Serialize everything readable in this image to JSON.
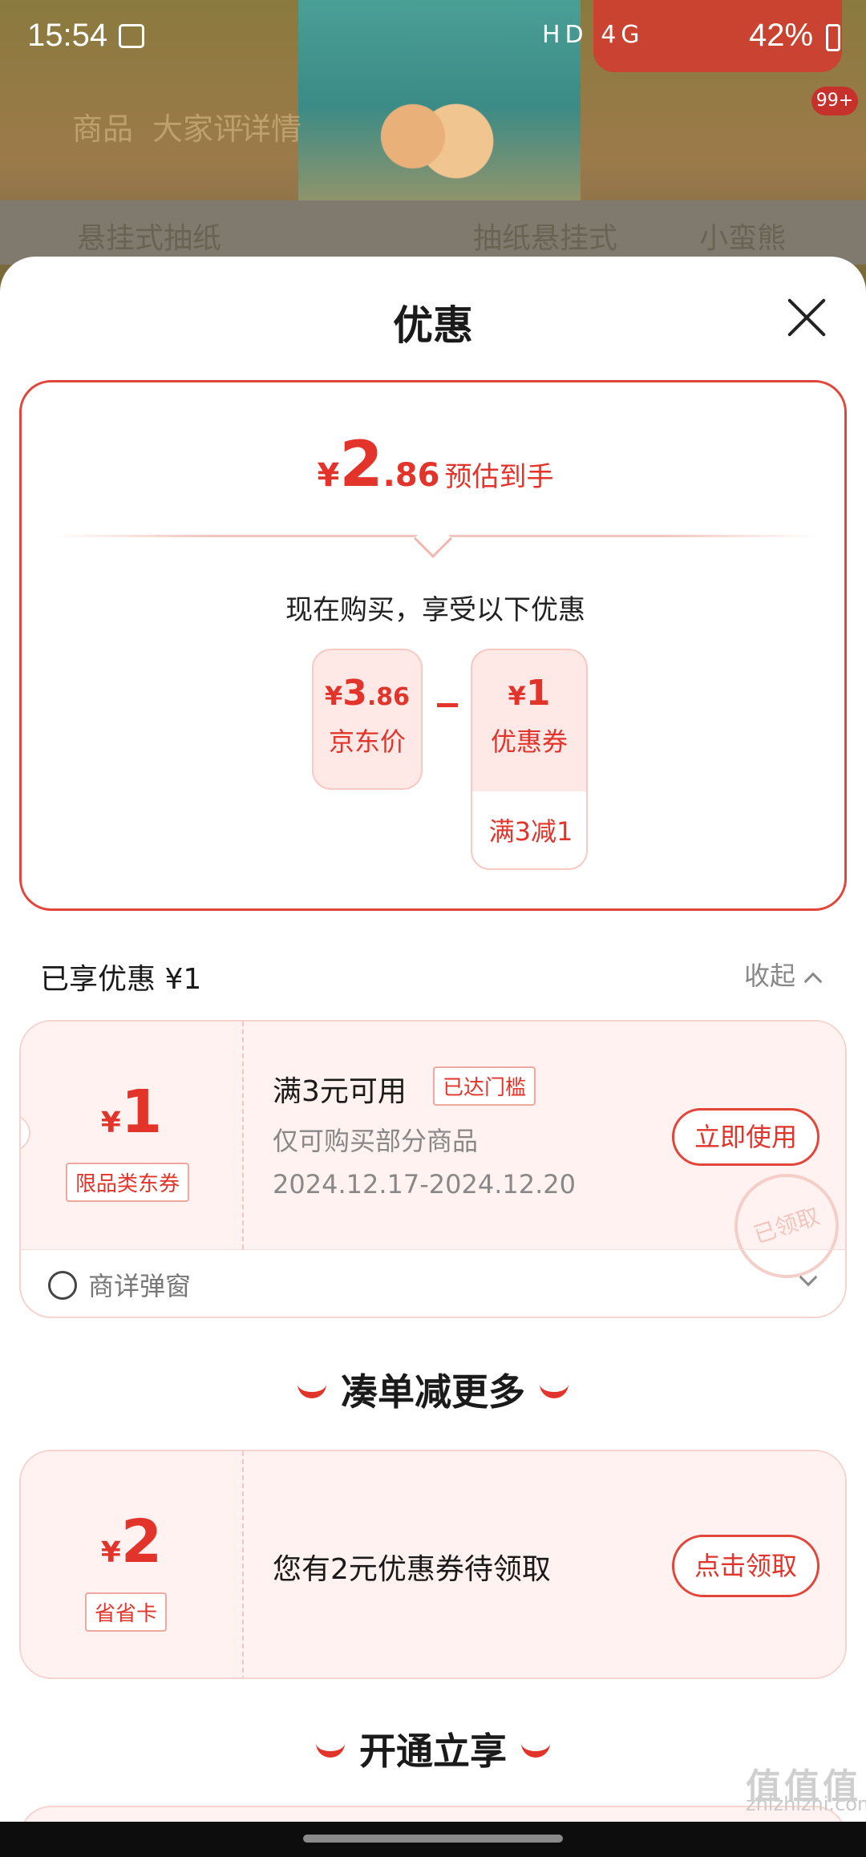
{
  "status_bar": {
    "time": "15:54",
    "icons": "HD 4G",
    "battery": "42%"
  },
  "background": {
    "nav_tabs": [
      "商品",
      "大家评",
      "详情"
    ],
    "badge": "99+",
    "search_placeholder": "悬挂式抽纸",
    "search_chips": [
      "抽纸悬挂式",
      "小蛮熊"
    ]
  },
  "sheet": {
    "title": "优惠",
    "estimate": {
      "currency": "¥",
      "integer": "2",
      "decimal": ".86",
      "label": "预估到手"
    },
    "subtitle": "现在购买，享受以下优惠",
    "price_box": {
      "currency": "¥",
      "integer": "3",
      "decimal": ".86",
      "label": "京东价"
    },
    "coupon_box": {
      "currency": "¥",
      "integer": "1",
      "label": "优惠券",
      "condition": "满3减1"
    },
    "enjoyed_label": "已享优惠 ¥1",
    "collapse_label": "收起",
    "coupon1": {
      "currency": "¥",
      "value": "1",
      "type_tag": "限品类东券",
      "title": "满3元可用",
      "status_tag": "已达门槛",
      "desc": "仅可购买部分商品",
      "dates": "2024.12.17-2024.12.20",
      "button": "立即使用",
      "stamp": "已领取",
      "footer": "商详弹窗"
    },
    "section_more": "凑单减更多",
    "coupon2": {
      "currency": "¥",
      "value": "2",
      "type_tag": "省省卡",
      "title": "您有2元优惠券待领取",
      "button": "点击领取"
    },
    "section_open": "开通立享"
  },
  "watermark": {
    "logo": "值值值",
    "site": "zhizhizhi.com"
  },
  "colors": {
    "accent": "#e2342a",
    "card_bg": "#fff2f0"
  }
}
